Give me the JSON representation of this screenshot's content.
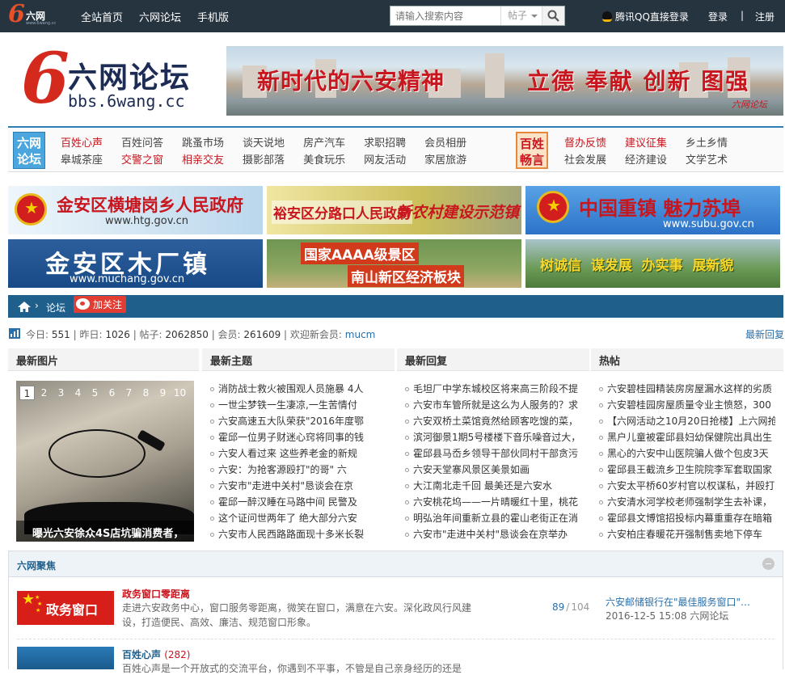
{
  "topbar": {
    "logo_name": "六网",
    "logo_url": "www.6wang.cc",
    "nav": [
      "全站首页",
      "六网论坛",
      "手机版"
    ],
    "search_placeholder": "请输入搜索内容",
    "search_scope": "帖子",
    "qq_login": "腾讯QQ直接登录",
    "login": "登录",
    "separator": "|",
    "register": "注册"
  },
  "header": {
    "logo_cn": "六网论坛",
    "logo_en": "bbs.6wang.cc",
    "banner_slogan_1": "新时代的六安精神",
    "banner_slogan_2": "立德 奉献 创新 图强",
    "banner_tag": "六网论坛"
  },
  "catnav": {
    "logo1": "六网论坛",
    "logo2": "百姓畅言",
    "group1": [
      {
        "label": "百姓心声",
        "red": true
      },
      {
        "label": "皋城茶座",
        "red": false
      },
      {
        "label": "百姓问答",
        "red": false
      },
      {
        "label": "交警之窗",
        "red": true
      },
      {
        "label": "跳蚤市场",
        "red": false
      },
      {
        "label": "相亲交友",
        "red": true
      },
      {
        "label": "谈天说地",
        "red": false
      },
      {
        "label": "摄影部落",
        "red": false
      },
      {
        "label": "房产汽车",
        "red": false
      },
      {
        "label": "美食玩乐",
        "red": false
      },
      {
        "label": "求职招聘",
        "red": false
      },
      {
        "label": "网友活动",
        "red": false
      },
      {
        "label": "会员相册",
        "red": false
      },
      {
        "label": "家居旅游",
        "red": false
      }
    ],
    "group2": [
      {
        "label": "督办反馈",
        "red": true
      },
      {
        "label": "社会发展",
        "red": false
      },
      {
        "label": "建议征集",
        "red": true
      },
      {
        "label": "经济建设",
        "red": false
      },
      {
        "label": "乡土乡情",
        "red": false
      },
      {
        "label": "文学艺术",
        "red": false
      }
    ]
  },
  "ads": {
    "ad1_title": "金安区横塘岗乡人民政府",
    "ad1_url": "www.htg.gov.cn",
    "ad2_title": "裕安区分路口人民政府",
    "ad2_sub": "新农村建设示范镇",
    "ad3_title": "中国重镇 魅力苏埠",
    "ad3_url": "www.subu.gov.cn",
    "ad4_title": "金安区木厂镇",
    "ad4_url": "www.muchang.gov.cn",
    "ad5_title": "国家AAAA级景区",
    "ad5_sub": "南山新区经济板块",
    "ad6_title": "树诚信  谋发展  办实事  展新貌"
  },
  "breadcrumb": {
    "forum": "论坛",
    "follow": "加关注"
  },
  "stats": {
    "today_label": "今日:",
    "today": "551",
    "yesterday_label": "昨日:",
    "yesterday": "1026",
    "posts_label": "帖子:",
    "posts": "2062850",
    "members_label": "会员:",
    "members": "261609",
    "welcome_label": "欢迎新会员:",
    "new_member": "mucm",
    "latest_reply": "最新回复"
  },
  "columns": {
    "pictures": "最新图片",
    "topics": "最新主题",
    "replies": "最新回复",
    "hot": "热帖"
  },
  "pictures": {
    "pages": [
      "1",
      "2",
      "3",
      "4",
      "5",
      "6",
      "7",
      "8",
      "9",
      "10"
    ],
    "active_page": "1",
    "caption": "曝光六安徐众4S店坑骗消费者，"
  },
  "new_topics": [
    "消防战士救火被围观人员施暴 4人",
    "一世尘梦铁一生凄凉,一生苦情付",
    "六安高速五大队荣获\"2016年度鄂",
    "霍邱一位男子财迷心窍将同事的钱",
    "六安人看过来 这些养老金的新规",
    "六安：为抢客源殴打\"的哥\" 六",
    "六安市\"走进中关村\"恳谈会在京",
    "霍邱一醉汉睡在马路中间 民警及",
    "这个证问世两年了 绝大部分六安",
    "六安市人民西路路面现十多米长裂"
  ],
  "new_replies": [
    "毛坦厂中学东城校区将来高三阶段不提",
    "六安市车管所就是这么为人服务的？求",
    "六安双桥土菜馆竟然给顾客吃馊的菜，",
    "滨河御景1期5号楼楼下音乐噪音过大，",
    "霍邱县马岙乡领导干部伙同村干部贪污",
    "六安天堂寨风景区美景如画",
    "大江南北走千回 最美还是六安水",
    "六安桃花坞——一片晴暖红十里，桃花",
    "明弘治年间重新立县的霍山老街正在消",
    "六安市\"走进中关村\"恳谈会在京举办"
  ],
  "hot_posts": [
    "六安碧桂园精装房房屋漏水这样的劣质",
    "六安碧桂园房屋质量令业主愤怒，300",
    "【六网活动之10月20日抢楼】上六网抢",
    "黑户儿童被霍邱县妇幼保健院出具出生",
    "黑心的六安中山医院骗人做个包皮3天",
    "霍邱县王截流乡卫生院院李军套取国家",
    "六安太平桥60岁村官以权谋私，并殴打",
    "六安清水河学校老师强制学生去补课，",
    "霍邱县文博馆招投标内幕重重存在暗箱",
    "六安柏庄春暖花开强制售卖地下停车"
  ],
  "focus": {
    "title": "六网聚焦",
    "forum1": {
      "icon_text": "政务窗口",
      "name": "政务窗口零距离",
      "desc": "走进六安政务中心，窗口服务零距离，微笑在窗口，满意在六安。深化政风行风建设，打造便民、高效、廉洁、规范窗口形象。",
      "threads": "89",
      "slash": "/",
      "posts": "104",
      "last_title": "六安邮储银行在\"最佳服务窗口\"…",
      "last_meta": "2016-12-5 15:08 六网论坛"
    },
    "forum2": {
      "name": "百姓心声",
      "count": "(282)",
      "desc": "百姓心声是一个开放式的交流平台，你遇到不平事，不管是自己亲身经历的还是"
    }
  }
}
